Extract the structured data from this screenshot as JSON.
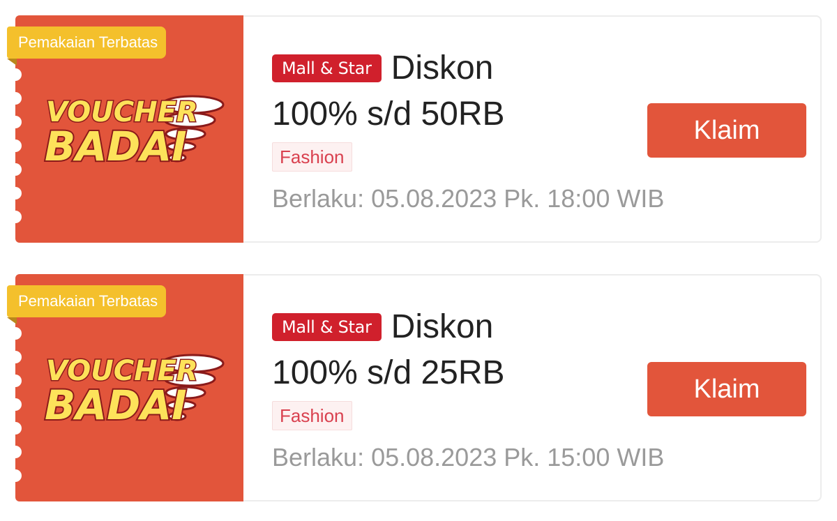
{
  "vouchers": [
    {
      "ribbon": "Pemakaian Terbatas",
      "logo_line1": "VOUCHER",
      "logo_line2": "BADAI",
      "badge": "Mall & Star",
      "title_line1": "Diskon",
      "title_line2": "100% s/d 50RB",
      "category": "Fashion",
      "validity": "Berlaku: 05.08.2023 Pk. 18:00 WIB",
      "claim_label": "Klaim"
    },
    {
      "ribbon": "Pemakaian Terbatas",
      "logo_line1": "VOUCHER",
      "logo_line2": "BADAI",
      "badge": "Mall & Star",
      "title_line1": "Diskon",
      "title_line2": "100% s/d 25RB",
      "category": "Fashion",
      "validity": "Berlaku: 05.08.2023 Pk. 15:00 WIB",
      "claim_label": "Klaim"
    }
  ],
  "colors": {
    "accent": "#e2553b",
    "ribbon": "#f4c02c",
    "badge": "#d0202c",
    "category_text": "#d9414f",
    "muted_text": "#9a9a9a",
    "logo_fill": "#fde25a",
    "logo_outline": "#8a1a1a"
  },
  "icons": {
    "logo_graphic": "tornado-icon"
  }
}
